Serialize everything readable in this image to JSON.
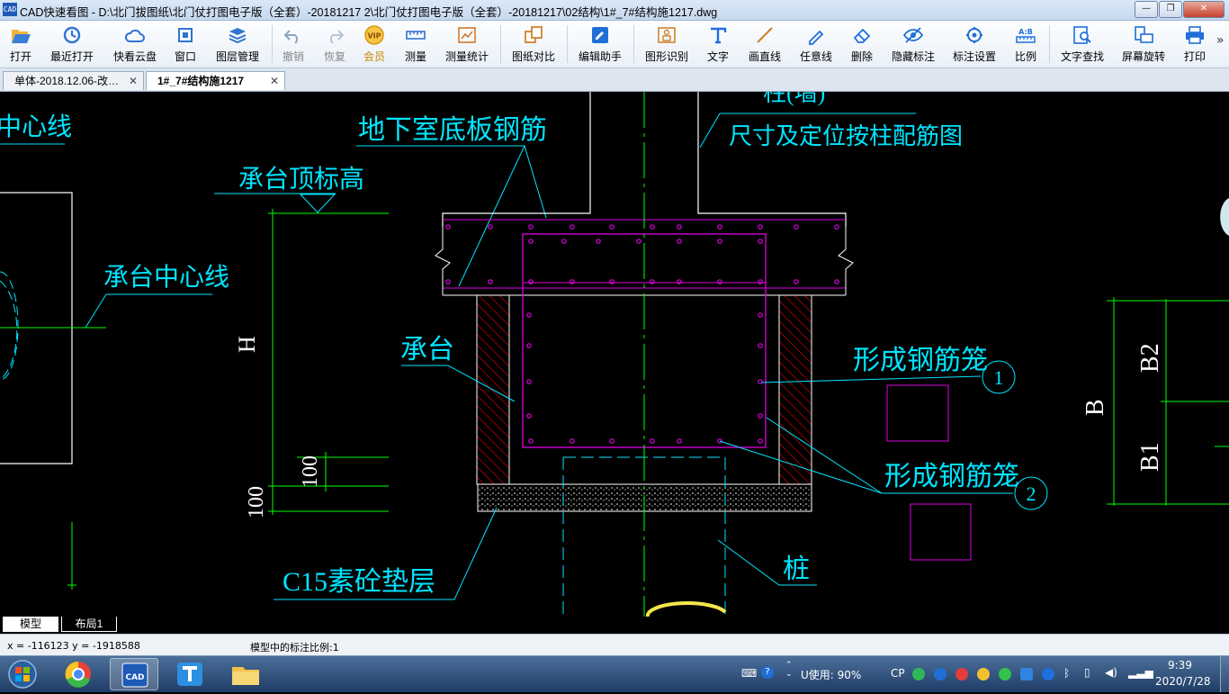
{
  "window": {
    "icon_text": "CAD",
    "title": "CAD快速看图 - D:\\北门拔图纸\\北门仗打图电子版（全套）-20181217 2\\北门仗打图电子版（全套）-20181217\\02结构\\1#_7#结构施1217.dwg",
    "minimize": "—",
    "maximize": "❐",
    "close": "✕"
  },
  "toolbar": {
    "items": [
      {
        "label": "打开",
        "icon": "folder-open-icon"
      },
      {
        "label": "最近打开",
        "icon": "history-icon"
      },
      {
        "label": "快看云盘",
        "icon": "cloud-icon"
      },
      {
        "label": "窗口",
        "icon": "window-icon"
      },
      {
        "label": "图层管理",
        "icon": "layers-icon"
      },
      {
        "label": "撤销",
        "icon": "undo-icon"
      },
      {
        "label": "恢复",
        "icon": "redo-icon"
      },
      {
        "label": "会员",
        "icon": "vip-icon",
        "badge": "VIP"
      },
      {
        "label": "测量",
        "icon": "ruler-icon"
      },
      {
        "label": "测量统计",
        "icon": "measure-stats-icon"
      },
      {
        "label": "图纸对比",
        "icon": "compare-icon"
      },
      {
        "label": "编辑助手",
        "icon": "edit-assistant-icon"
      },
      {
        "label": "图形识别",
        "icon": "shape-recognize-icon"
      },
      {
        "label": "文字",
        "icon": "text-icon"
      },
      {
        "label": "画直线",
        "icon": "line-icon"
      },
      {
        "label": "任意线",
        "icon": "freehand-icon"
      },
      {
        "label": "删除",
        "icon": "eraser-icon"
      },
      {
        "label": "隐藏标注",
        "icon": "hide-annotation-icon"
      },
      {
        "label": "标注设置",
        "icon": "annotation-settings-icon"
      },
      {
        "label": "比例",
        "icon": "scale-icon",
        "badge": "A:B"
      },
      {
        "label": "文字查找",
        "icon": "text-search-icon"
      },
      {
        "label": "屏幕旋转",
        "icon": "rotate-screen-icon"
      },
      {
        "label": "打印",
        "icon": "printer-icon"
      }
    ],
    "more": "»"
  },
  "tabs": [
    {
      "label": "单体-2018.12.06-改…",
      "close": "✕"
    },
    {
      "label": "1#_7#结构施1217",
      "close": "✕"
    }
  ],
  "drawing": {
    "labels": {
      "center_line_top": "中心线",
      "slab_rebar": "地下室底板钢筋",
      "column_top": "柱(墙)",
      "column_note": "尺寸及定位按柱配筋图",
      "cap_top_elev": "承台顶标高",
      "cap_center_line": "承台中心线",
      "cap": "承台",
      "dim_h": "H",
      "dim_100a": "100",
      "dim_100b": "100",
      "cage1": "形成钢筋笼",
      "cage2": "形成钢筋笼",
      "callout1": "1",
      "callout2": "2",
      "cushion": "C15素砼垫层",
      "pile": "桩",
      "dim_b": "B",
      "dim_b1": "B1",
      "dim_b2": "B2"
    },
    "colors": {
      "cyan": "#00e5ff",
      "green": "#00ff00",
      "magenta": "#e000e0",
      "red": "#e00000",
      "white": "#ffffff"
    }
  },
  "layout_tabs": [
    {
      "label": "模型"
    },
    {
      "label": "布局1"
    }
  ],
  "status": {
    "coords": "x = -116123  y = -1918588",
    "scale_text": "模型中的标注比例:1"
  },
  "taskbar": {
    "apps": [
      "start-orb-icon",
      "chrome-icon",
      "cad-viewer-icon",
      "text-app-icon",
      "file-explorer-icon"
    ],
    "tray_usage": "U使用: 90%",
    "tray_ime": "CP",
    "time": "9:39",
    "date": "2020/7/28"
  }
}
